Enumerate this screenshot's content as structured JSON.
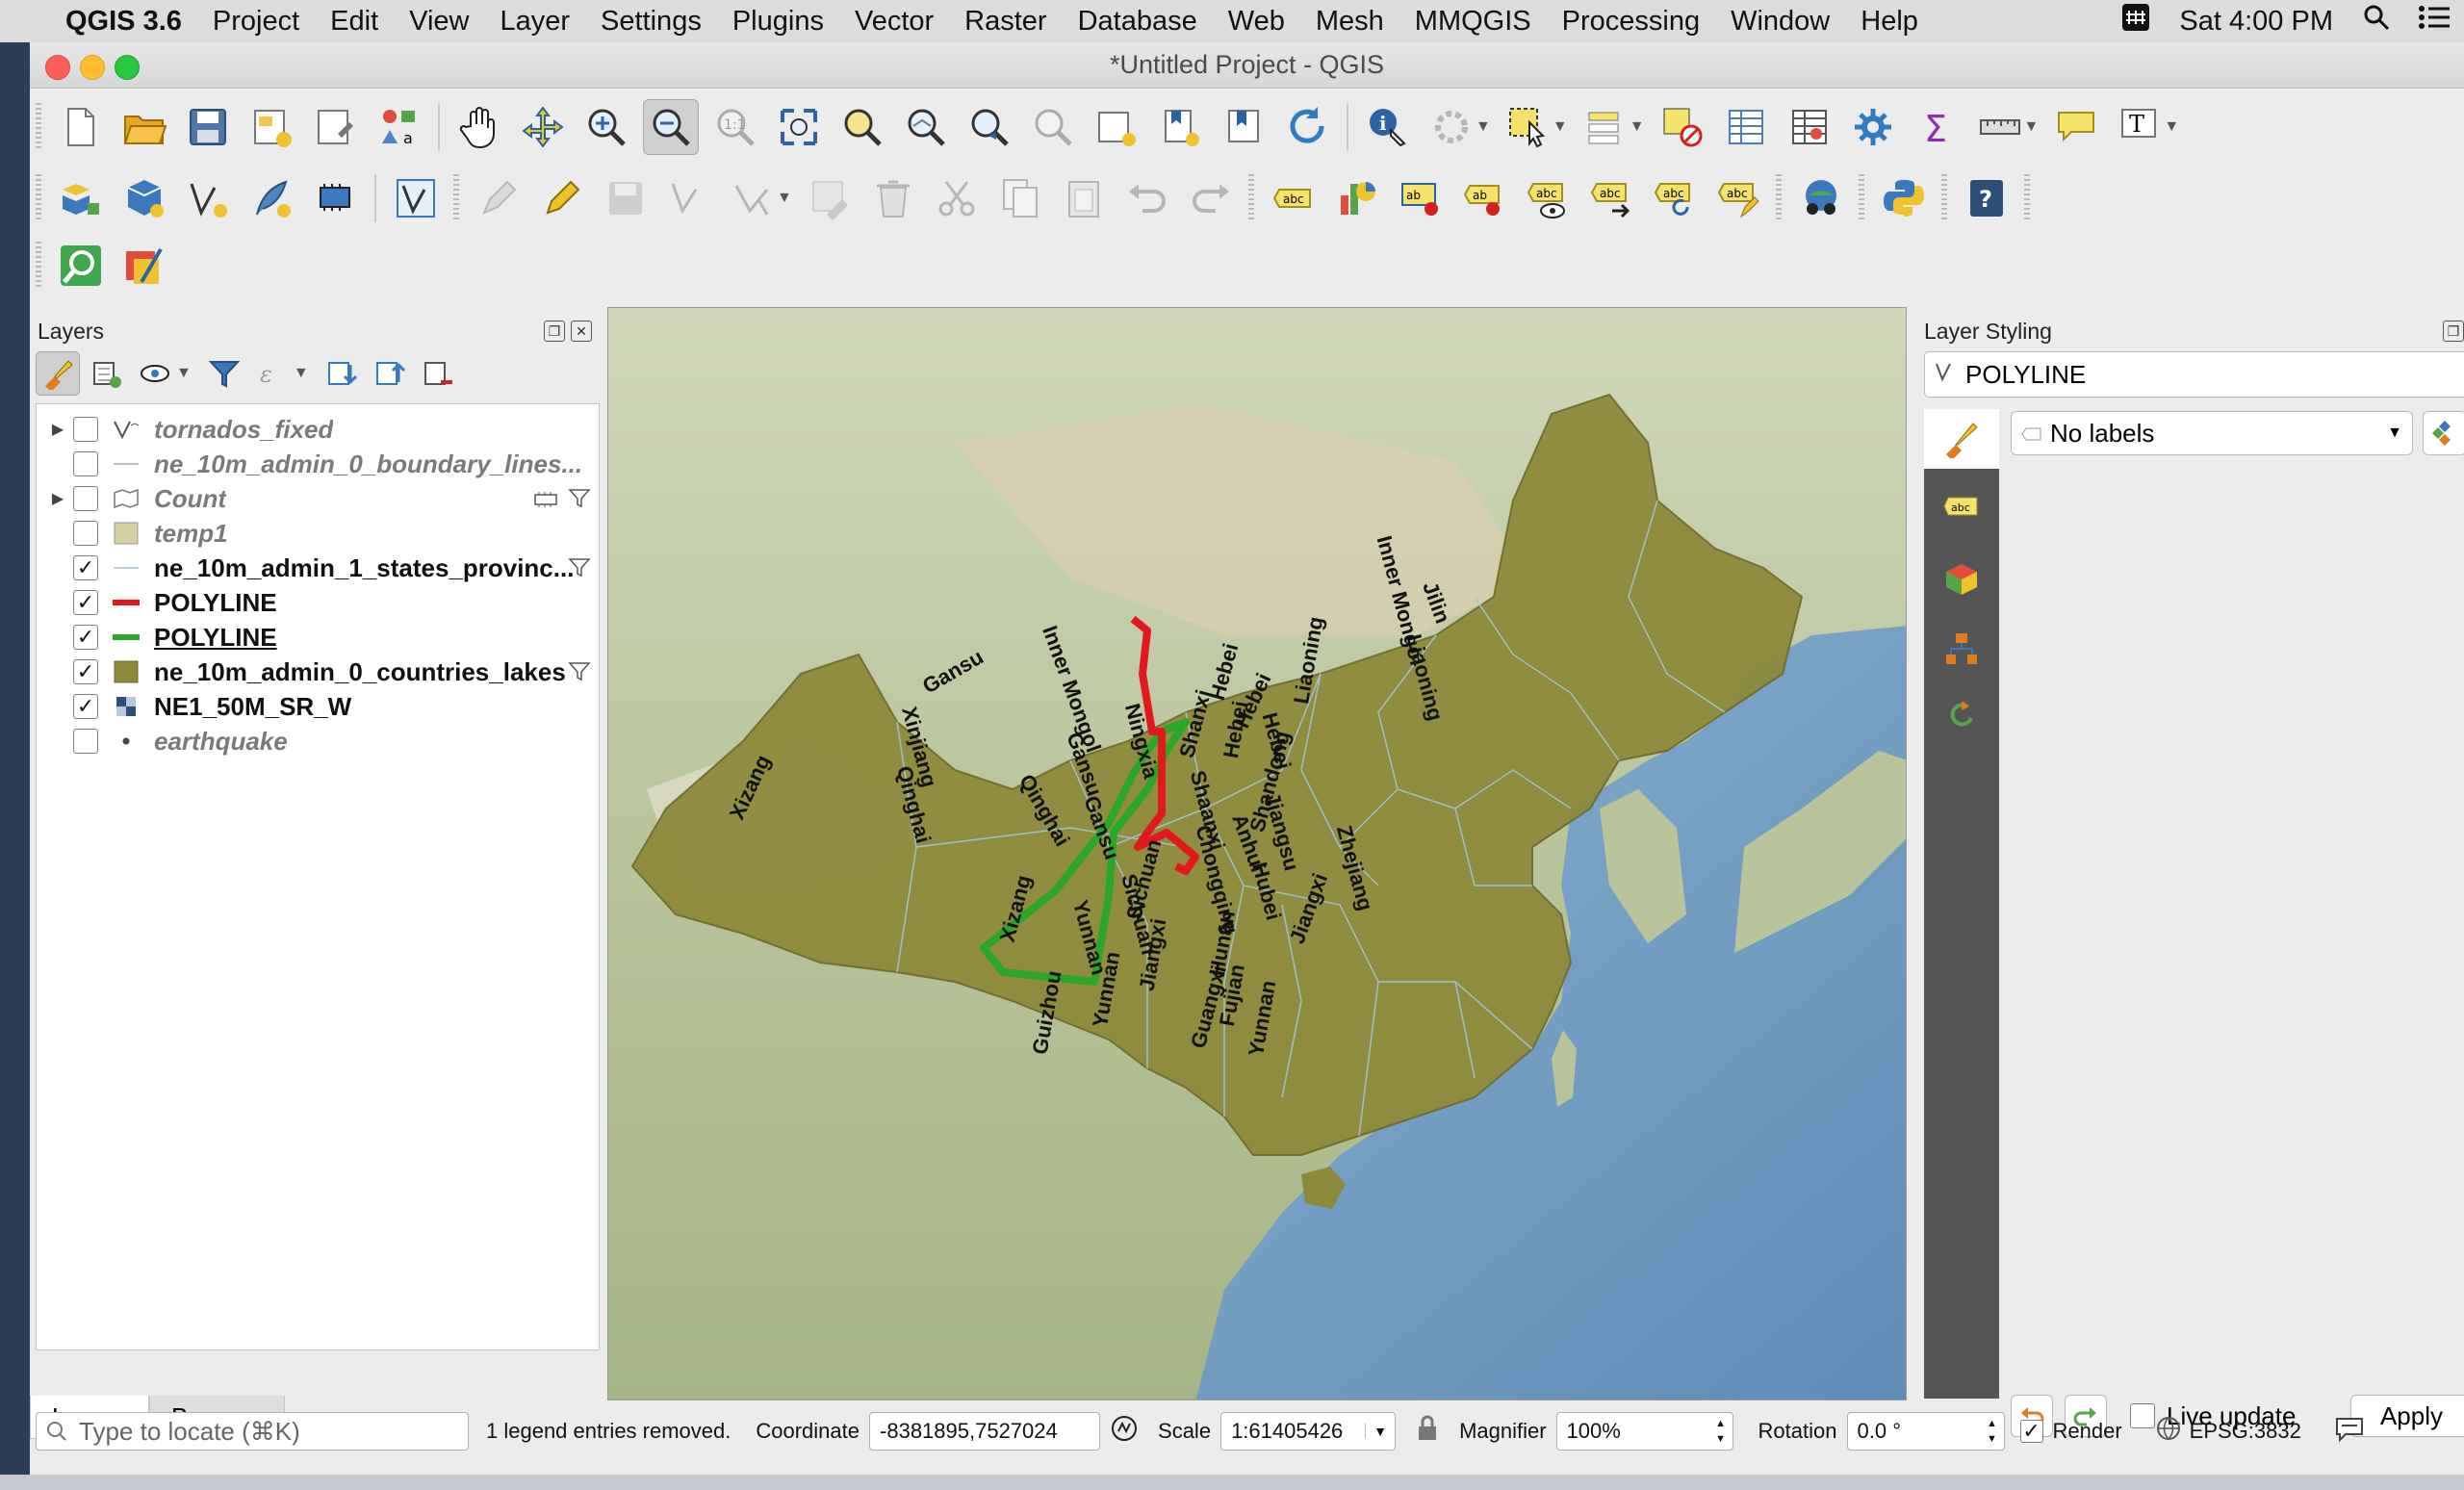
{
  "menubar": {
    "app": "QGIS 3.6",
    "items": [
      "Project",
      "Edit",
      "View",
      "Layer",
      "Settings",
      "Plugins",
      "Vector",
      "Raster",
      "Database",
      "Web",
      "Mesh",
      "MMQGIS",
      "Processing",
      "Window",
      "Help"
    ],
    "input_icon": "input-method-icon",
    "clock": "Sat 4:00 PM"
  },
  "window": {
    "title": "*Untitled Project - QGIS"
  },
  "layers_panel": {
    "title": "Layers",
    "layers": [
      {
        "name": "tornados_fixed",
        "checked": false,
        "expandable": true,
        "icon": "line-layer-icon",
        "style": "off"
      },
      {
        "name": "ne_10m_admin_0_boundary_lines...",
        "checked": false,
        "expandable": false,
        "icon": "thin-line-icon",
        "style": "off"
      },
      {
        "name": "Count",
        "checked": false,
        "expandable": true,
        "icon": "heatmap-layer-icon",
        "style": "off"
      },
      {
        "name": "temp1",
        "checked": false,
        "expandable": false,
        "icon": "polygon-swatch-icon",
        "style": "off"
      },
      {
        "name": "ne_10m_admin_1_states_provinc...",
        "checked": true,
        "expandable": false,
        "icon": "thin-line-icon",
        "style": "on"
      },
      {
        "name": "POLYLINE",
        "checked": true,
        "expandable": false,
        "icon": "red-line-icon",
        "style": "on"
      },
      {
        "name": "POLYLINE",
        "checked": true,
        "expandable": false,
        "icon": "green-line-icon",
        "style": "on-underline"
      },
      {
        "name": "ne_10m_admin_0_countries_lakes",
        "checked": true,
        "expandable": false,
        "icon": "olive-polygon-icon",
        "style": "on"
      },
      {
        "name": "NE1_50M_SR_W",
        "checked": true,
        "expandable": false,
        "icon": "raster-layer-icon",
        "style": "on"
      },
      {
        "name": "earthquake",
        "checked": false,
        "expandable": false,
        "icon": "point-layer-icon",
        "style": "off"
      }
    ],
    "tabs": [
      "Layers",
      "Browser"
    ]
  },
  "map": {
    "province_labels": [
      "Xizang",
      "Xinjiang",
      "Qinghai",
      "Gansu",
      "Inner Mongol",
      "Gansu",
      "Qinghai",
      "Ningxia",
      "Shanxi",
      "Hebei",
      "Hebei",
      "Liaoning",
      "Inner Mongol",
      "Liaoning",
      "Jilin",
      "Hebei",
      "Hebei",
      "Shandong",
      "Jiangsu",
      "Shaanxi",
      "Gansu",
      "Sichuan",
      "Chongqing",
      "Anhui",
      "Zhejiang",
      "Hubei",
      "Hunan",
      "Sichuan",
      "Yunnan",
      "Xizang",
      "Guizhou",
      "Jiangxi",
      "Fujian",
      "Yunnan",
      "Yunnan",
      "Guangxi",
      "Jiangxi"
    ],
    "colors": {
      "land": "#8e8a3c",
      "sea": "#7aa4c6",
      "route_red": "#e2191c",
      "route_green": "#2aa629"
    }
  },
  "styling_panel": {
    "title": "Layer Styling",
    "selected_layer": "POLYLINE",
    "labels_mode": "No labels",
    "live_update_label": "Live update",
    "live_update_checked": false,
    "apply_label": "Apply"
  },
  "statusbar": {
    "locator_placeholder": "Type to locate (⌘K)",
    "message": "1 legend entries removed.",
    "coordinate_label": "Coordinate",
    "coordinate_value": "-8381895,7527024",
    "scale_label": "Scale",
    "scale_value": "1:61405426",
    "magnifier_label": "Magnifier",
    "magnifier_value": "100%",
    "rotation_label": "Rotation",
    "rotation_value": "0.0 °",
    "render_label": "Render",
    "render_checked": true,
    "crs": "EPSG:3832"
  }
}
